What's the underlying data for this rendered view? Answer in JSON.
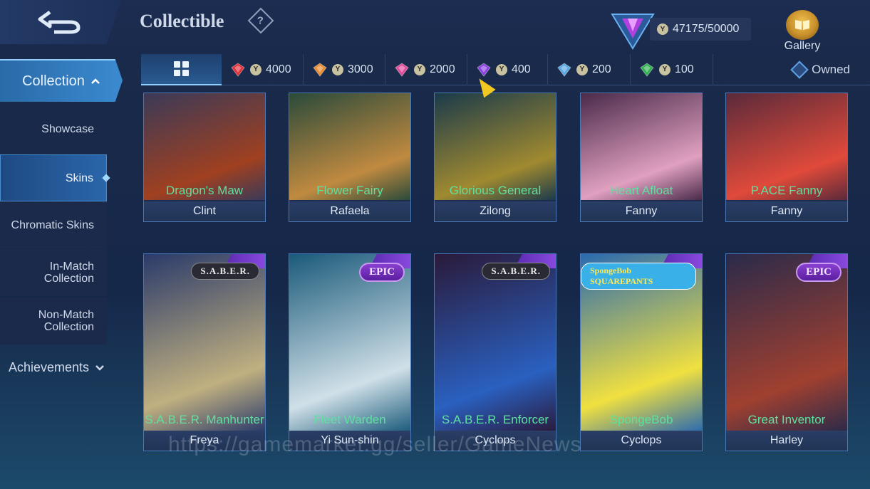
{
  "header": {
    "title": "Collectible",
    "help": "?",
    "points": "47175/50000",
    "gallery_label": "Gallery"
  },
  "sidebar": {
    "collection": "Collection",
    "items": [
      {
        "label": "Showcase"
      },
      {
        "label": "Skins"
      },
      {
        "label": "Chromatic Skins"
      },
      {
        "label": "In-Match Collection"
      },
      {
        "label": "Non-Match Collection"
      }
    ],
    "achievements": "Achievements"
  },
  "filters": {
    "tabs": [
      {
        "value": "4000",
        "color": "#e0303a"
      },
      {
        "value": "3000",
        "color": "#e88a30"
      },
      {
        "value": "2000",
        "color": "#e04a9a"
      },
      {
        "value": "400",
        "color": "#8a40e0"
      },
      {
        "value": "200",
        "color": "#5aa8e0"
      },
      {
        "value": "100",
        "color": "#30b050"
      }
    ],
    "owned": "Owned"
  },
  "cards_row1": [
    {
      "skin": "Dragon's Maw",
      "hero": "Clint",
      "art": [
        "#3a3a58",
        "#a04020"
      ]
    },
    {
      "skin": "Flower Fairy",
      "hero": "Rafaela",
      "art": [
        "#2a4a3a",
        "#c08a40"
      ]
    },
    {
      "skin": "Glorious General",
      "hero": "Zilong",
      "art": [
        "#1a3a4a",
        "#a08a30"
      ]
    },
    {
      "skin": "Heart Afloat",
      "hero": "Fanny",
      "art": [
        "#4a2a4a",
        "#e0a0c0"
      ]
    },
    {
      "skin": "P.ACE Fanny",
      "hero": "Fanny",
      "art": [
        "#5a2a3a",
        "#e04a3a"
      ]
    }
  ],
  "cards_row2": [
    {
      "skin": "S.A.B.E.R. Manhunter",
      "hero": "Freya",
      "badge": "S.A.B.E.R.",
      "badge_type": "saber",
      "art": [
        "#2a3a6a",
        "#c0b080"
      ]
    },
    {
      "skin": "Fleet Warden",
      "hero": "Yi Sun-shin",
      "badge": "EPIC",
      "badge_type": "epic",
      "art": [
        "#1a5a7a",
        "#d0e0e8"
      ]
    },
    {
      "skin": "S.A.B.E.R. Enforcer",
      "hero": "Cyclops",
      "badge": "S.A.B.E.R.",
      "badge_type": "saber",
      "art": [
        "#2a1a3a",
        "#2a60c0"
      ]
    },
    {
      "skin": "SpongeBob",
      "hero": "Cyclops",
      "badge": "SpongeBob SQUAREPANTS",
      "badge_type": "sponge",
      "art": [
        "#2a6ab0",
        "#f0e040"
      ]
    },
    {
      "skin": "Great Inventor",
      "hero": "Harley",
      "badge": "EPIC",
      "badge_type": "epic",
      "art": [
        "#2a2a4a",
        "#a04030"
      ]
    }
  ],
  "watermark": "https://gamemarket.gg/seller/GameNews"
}
